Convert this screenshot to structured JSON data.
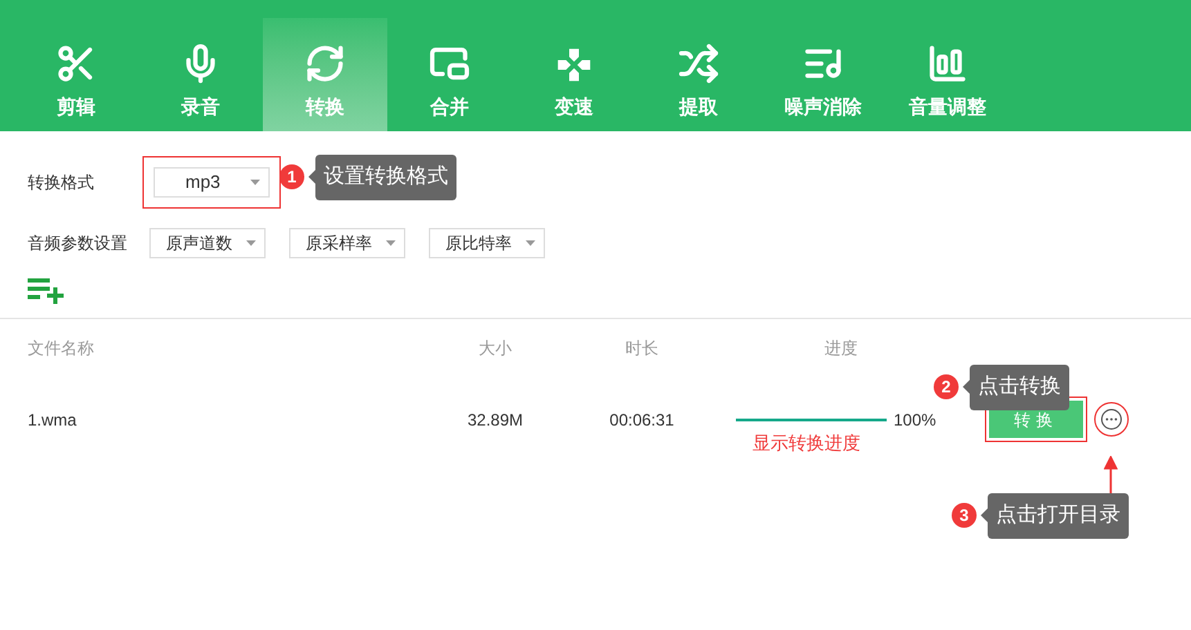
{
  "toolbar": [
    {
      "label": "剪辑",
      "selected": false
    },
    {
      "label": "录音",
      "selected": false
    },
    {
      "label": "转换",
      "selected": true
    },
    {
      "label": "合并",
      "selected": false
    },
    {
      "label": "变速",
      "selected": false
    },
    {
      "label": "提取",
      "selected": false
    },
    {
      "label": "噪声消除",
      "selected": false
    },
    {
      "label": "音量调整",
      "selected": false
    }
  ],
  "format": {
    "label": "转换格式",
    "value": "mp3",
    "highlighted": true
  },
  "params": {
    "label": "音频参数设置",
    "selects": [
      "原声道数",
      "原采样率",
      "原比特率"
    ]
  },
  "table": {
    "columns": [
      "文件名称",
      "大小",
      "时长",
      "进度"
    ],
    "rows": [
      {
        "name": "1.wma",
        "size": "32.89M",
        "duration": "00:06:31",
        "level": 1.0,
        "percent": "100%",
        "progress_note": "显示转换进度",
        "button": "转换",
        "button_highlighted": true,
        "folder_highlighted": true
      }
    ]
  },
  "annotations": [
    {
      "number": "1",
      "text": "设置转换格式"
    },
    {
      "number": "2",
      "text": "点击转换"
    },
    {
      "number": "3",
      "text": "点击打开目录"
    }
  ]
}
